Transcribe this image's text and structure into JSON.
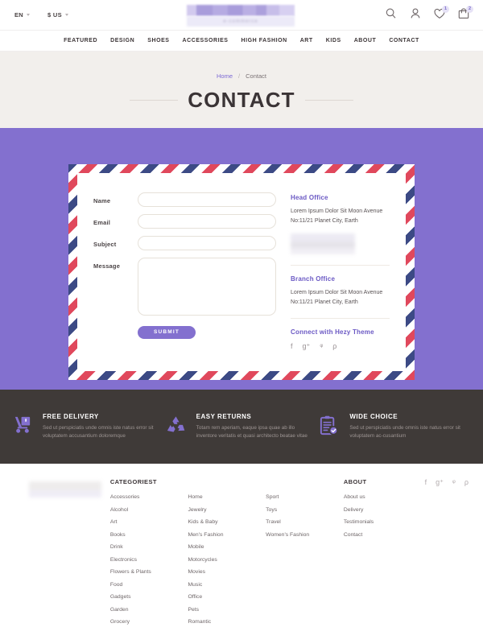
{
  "topbar": {
    "language": "EN",
    "currency": "$ US",
    "logo_caption": "e-commerce",
    "icons": {
      "search": "search-icon",
      "account": "user-icon",
      "wishlist": "heart-icon",
      "wishlist_count": "1",
      "cart": "cart-icon",
      "cart_count": "2"
    }
  },
  "nav": {
    "items": [
      {
        "label": "FEATURED"
      },
      {
        "label": "DESIGN"
      },
      {
        "label": "SHOES"
      },
      {
        "label": "ACCESSORIES"
      },
      {
        "label": "HIGH FASHION"
      },
      {
        "label": "ART"
      },
      {
        "label": "KIDS"
      },
      {
        "label": "ABOUT"
      },
      {
        "label": "CONTACT"
      }
    ]
  },
  "page": {
    "breadcrumb_home": "Home",
    "breadcrumb_sep": "/",
    "breadcrumb_current": "Contact",
    "title": "CONTACT"
  },
  "form": {
    "name_label": "Name",
    "name_value": "",
    "name_placeholder": "",
    "email_label": "Email",
    "email_value": "",
    "email_placeholder": "",
    "subject_label": "Subject",
    "subject_value": "",
    "subject_placeholder": "",
    "message_label": "Message",
    "message_value": "",
    "message_placeholder": "",
    "submit_label": "SUBMIT"
  },
  "contact_info": {
    "head_office_title": "Head Office",
    "head_office_line1": "Lorem Ipsum Dolor Sit Moon Avenue",
    "head_office_line2": "No:11/21 Planet City, Earth",
    "branch_office_title": "Branch Office",
    "branch_office_line1": "Lorem Ipsum Dolor Sit Moon Avenue",
    "branch_office_line2": "No:11/21 Planet City, Earth",
    "connect_title": "Connect with Hezy Theme",
    "socials": [
      {
        "name": "facebook-icon",
        "glyph": "f"
      },
      {
        "name": "google-plus-icon",
        "glyph": "g⁺"
      },
      {
        "name": "twitter-icon",
        "glyph": "ᵠ"
      },
      {
        "name": "pinterest-icon",
        "glyph": "ρ"
      }
    ]
  },
  "features": [
    {
      "icon": "delivery-trolley-icon",
      "title": "FREE DELIVERY",
      "text": "Sed ut perspiciatis unde omnis iste natus error sit voluptatem accusantium doloremque"
    },
    {
      "icon": "recycle-icon",
      "title": "EASY RETURNS",
      "text": "Totam rem aperiam, eaque ipsa quae ab illo inventore veritatis et quasi architecto beatae vitae"
    },
    {
      "icon": "clipboard-check-icon",
      "title": "WIDE CHOICE",
      "text": "Sed ut perspiciatis unde omnis iste natus error sit voluptatem ac-cusantium"
    }
  ],
  "footer": {
    "categories_title": "CATEGORIEST",
    "cat_col1": [
      "Accessories",
      "Alcohol",
      "Art",
      "Books",
      "Drink",
      "Electronics",
      "Flowers & Plants",
      "Food",
      "Gadgets",
      "Garden",
      "Grocery"
    ],
    "cat_col2": [
      "Home",
      "Jewelry",
      "Kids & Baby",
      "Men's Fashion",
      "Mobile",
      "Motorcycles",
      "Movies",
      "Music",
      "Office",
      "Pets",
      "Romantic"
    ],
    "cat_col3": [
      "Sport",
      "Toys",
      "Travel",
      "Women's Fashion"
    ],
    "about_title": "ABOUT",
    "about_links": [
      "About us",
      "Delivery",
      "Testimonials",
      "Contact"
    ],
    "socials": [
      {
        "name": "facebook-icon",
        "glyph": "f"
      },
      {
        "name": "google-plus-icon",
        "glyph": "g⁺"
      },
      {
        "name": "twitter-icon",
        "glyph": "ᵠ"
      },
      {
        "name": "pinterest-icon",
        "glyph": "ρ"
      }
    ]
  },
  "colors": {
    "purple": "#8370cf",
    "dark": "#3f3a38",
    "title_band": "#f2efec",
    "stripe_red": "#e0485c",
    "stripe_blue": "#3c4a85"
  }
}
